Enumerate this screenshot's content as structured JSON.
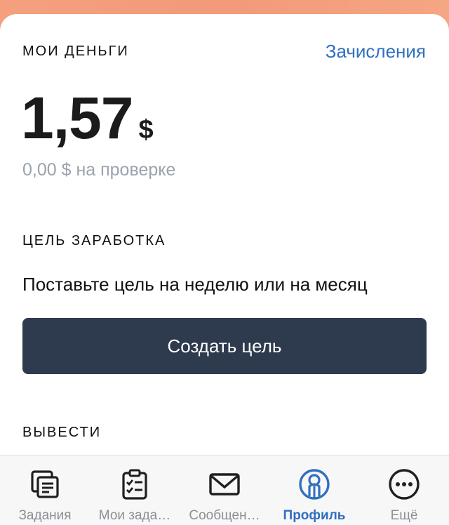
{
  "wallet": {
    "section_title": "МОИ ДЕНЬГИ",
    "accruals_link": "Зачисления",
    "balance_amount": "1,57",
    "balance_currency": "$",
    "pending_text": "0,00 $ на проверке"
  },
  "goal": {
    "section_title": "ЦЕЛЬ ЗАРАБОТКА",
    "description": "Поставьте цель на неделю или на месяц",
    "create_button": "Создать цель"
  },
  "withdraw": {
    "section_title": "ВЫВЕСТИ"
  },
  "tabbar": {
    "items": [
      {
        "label": "Задания",
        "icon": "tasks-icon"
      },
      {
        "label": "Мои зада…",
        "icon": "clipboard-checklist-icon"
      },
      {
        "label": "Сообщен…",
        "icon": "mail-icon"
      },
      {
        "label": "Профиль",
        "icon": "profile-icon",
        "active": true
      },
      {
        "label": "Ещё",
        "icon": "more-icon"
      }
    ]
  },
  "colors": {
    "accent": "#2f6fbf",
    "button_bg": "#2e3a4e",
    "muted_text": "#9aa3ad",
    "header_gradient": "#f4a07e"
  }
}
